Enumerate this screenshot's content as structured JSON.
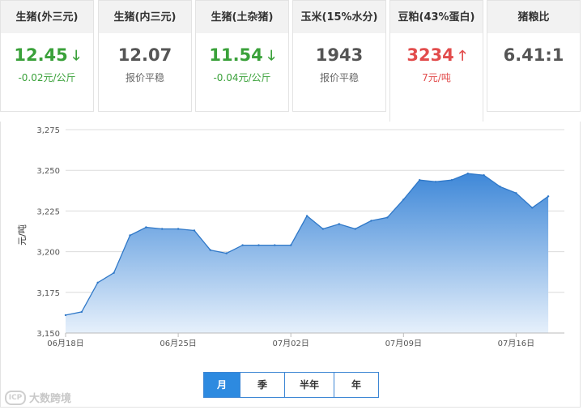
{
  "cards": [
    {
      "name": "生猪(外三元)",
      "value": "12.45",
      "trend": "down",
      "sub": "-0.02元/公斤"
    },
    {
      "name": "生猪(内三元)",
      "value": "12.07",
      "trend": "flat",
      "sub": "报价平稳"
    },
    {
      "name": "生猪(土杂猪)",
      "value": "11.54",
      "trend": "down",
      "sub": "-0.04元/公斤"
    },
    {
      "name": "玉米(15%水分)",
      "value": "1943",
      "trend": "flat",
      "sub": "报价平稳"
    },
    {
      "name": "豆粕(43%蛋白)",
      "value": "3234",
      "trend": "up",
      "sub": "7元/吨"
    },
    {
      "name": "猪粮比",
      "value": "6.41:1",
      "trend": "none",
      "sub": ""
    }
  ],
  "arrows": {
    "down": "🡓",
    "up": "🡑"
  },
  "colors": {
    "down": "#3aa13a",
    "up": "#e24c4c",
    "accent": "#2d8ae0",
    "area_top": "#3f88d8",
    "area_bottom": "#e6f0fb"
  },
  "chart_data": {
    "type": "area",
    "ylabel": "元/吨",
    "ylim": [
      3150,
      3275
    ],
    "yticks": [
      3150,
      3175,
      3200,
      3225,
      3250,
      3275
    ],
    "ytick_labels": [
      "3,150",
      "3,175",
      "3,200",
      "3,225",
      "3,250",
      "3,275"
    ],
    "x_start": "06-18",
    "x_end": "07-19",
    "xticks": [
      {
        "date": "06-18",
        "label": "06月18日"
      },
      {
        "date": "06-25",
        "label": "06月25日"
      },
      {
        "date": "07-02",
        "label": "07月02日"
      },
      {
        "date": "07-09",
        "label": "07月09日"
      },
      {
        "date": "07-16",
        "label": "07月16日"
      }
    ],
    "points": [
      {
        "date": "06-18",
        "y": 3161
      },
      {
        "date": "06-19",
        "y": 3163
      },
      {
        "date": "06-20",
        "y": 3181
      },
      {
        "date": "06-21",
        "y": 3187
      },
      {
        "date": "06-22",
        "y": 3210
      },
      {
        "date": "06-23",
        "y": 3215
      },
      {
        "date": "06-24",
        "y": 3214
      },
      {
        "date": "06-25",
        "y": 3214
      },
      {
        "date": "06-26",
        "y": 3213
      },
      {
        "date": "06-27",
        "y": 3201
      },
      {
        "date": "06-28",
        "y": 3199
      },
      {
        "date": "06-29",
        "y": 3204
      },
      {
        "date": "06-30",
        "y": 3204
      },
      {
        "date": "07-01",
        "y": 3204
      },
      {
        "date": "07-02",
        "y": 3204
      },
      {
        "date": "07-03",
        "y": 3222
      },
      {
        "date": "07-04",
        "y": 3214
      },
      {
        "date": "07-05",
        "y": 3217
      },
      {
        "date": "07-06",
        "y": 3214
      },
      {
        "date": "07-07",
        "y": 3219
      },
      {
        "date": "07-08",
        "y": 3221
      },
      {
        "date": "07-09",
        "y": 3232
      },
      {
        "date": "07-10",
        "y": 3244
      },
      {
        "date": "07-11",
        "y": 3243
      },
      {
        "date": "07-12",
        "y": 3244
      },
      {
        "date": "07-13",
        "y": 3248
      },
      {
        "date": "07-14",
        "y": 3247
      },
      {
        "date": "07-15",
        "y": 3240
      },
      {
        "date": "07-16",
        "y": 3236
      },
      {
        "date": "07-17",
        "y": 3227
      },
      {
        "date": "07-18",
        "y": 3234
      }
    ],
    "grid": true,
    "legend": "none"
  },
  "range_buttons": [
    {
      "label": "月",
      "active": true
    },
    {
      "label": "季",
      "active": false
    },
    {
      "label": "半年",
      "active": false
    },
    {
      "label": "年",
      "active": false
    }
  ],
  "watermark": {
    "logo": "ICP",
    "text": "大数跨境"
  }
}
